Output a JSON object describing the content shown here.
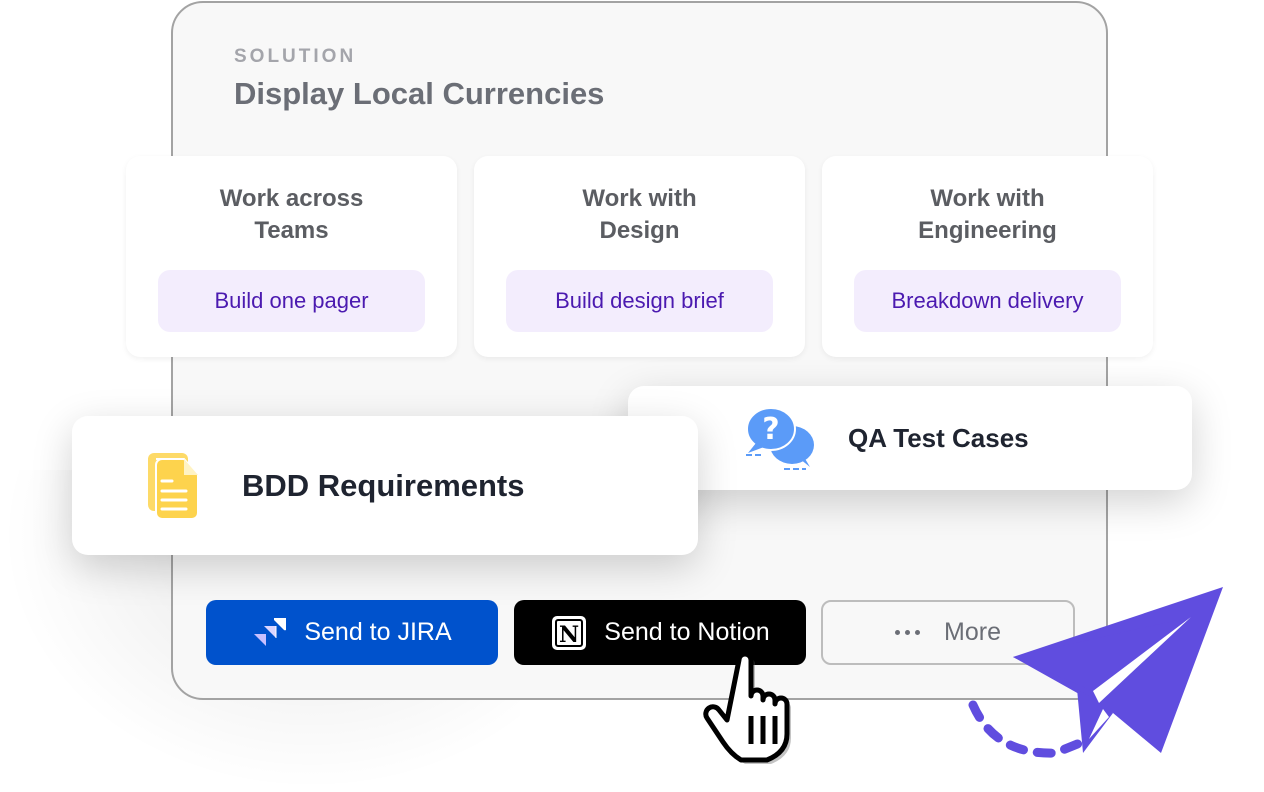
{
  "solution": {
    "eyebrow": "SOLUTION",
    "title": "Display Local Currencies"
  },
  "tiles": [
    {
      "heading_line1": "Work across",
      "heading_line2": "Teams",
      "action": "Build one pager"
    },
    {
      "heading_line1": "Work with",
      "heading_line2": "Design",
      "action": "Build design brief"
    },
    {
      "heading_line1": "Work with",
      "heading_line2": "Engineering",
      "action": "Breakdown delivery"
    }
  ],
  "cards": {
    "qa": {
      "label": "QA Test Cases",
      "icon": "question-chat-icon"
    },
    "bdd": {
      "label": "BDD Requirements",
      "icon": "document-icon"
    }
  },
  "actions": {
    "jira": {
      "label": "Send to JIRA",
      "icon": "jira-icon"
    },
    "notion": {
      "label": "Send to Notion",
      "icon": "notion-icon"
    },
    "more": {
      "label": "More",
      "icon": "more-dots-icon"
    }
  },
  "colors": {
    "jira_blue": "#0052cc",
    "notion_black": "#000000",
    "chip_bg": "#f3edfd",
    "chip_text": "#4b1ab0",
    "plane_purple": "#604ddf",
    "qa_icon_blue": "#5b9bf8",
    "doc_icon_yellow": "#fdd34d"
  }
}
